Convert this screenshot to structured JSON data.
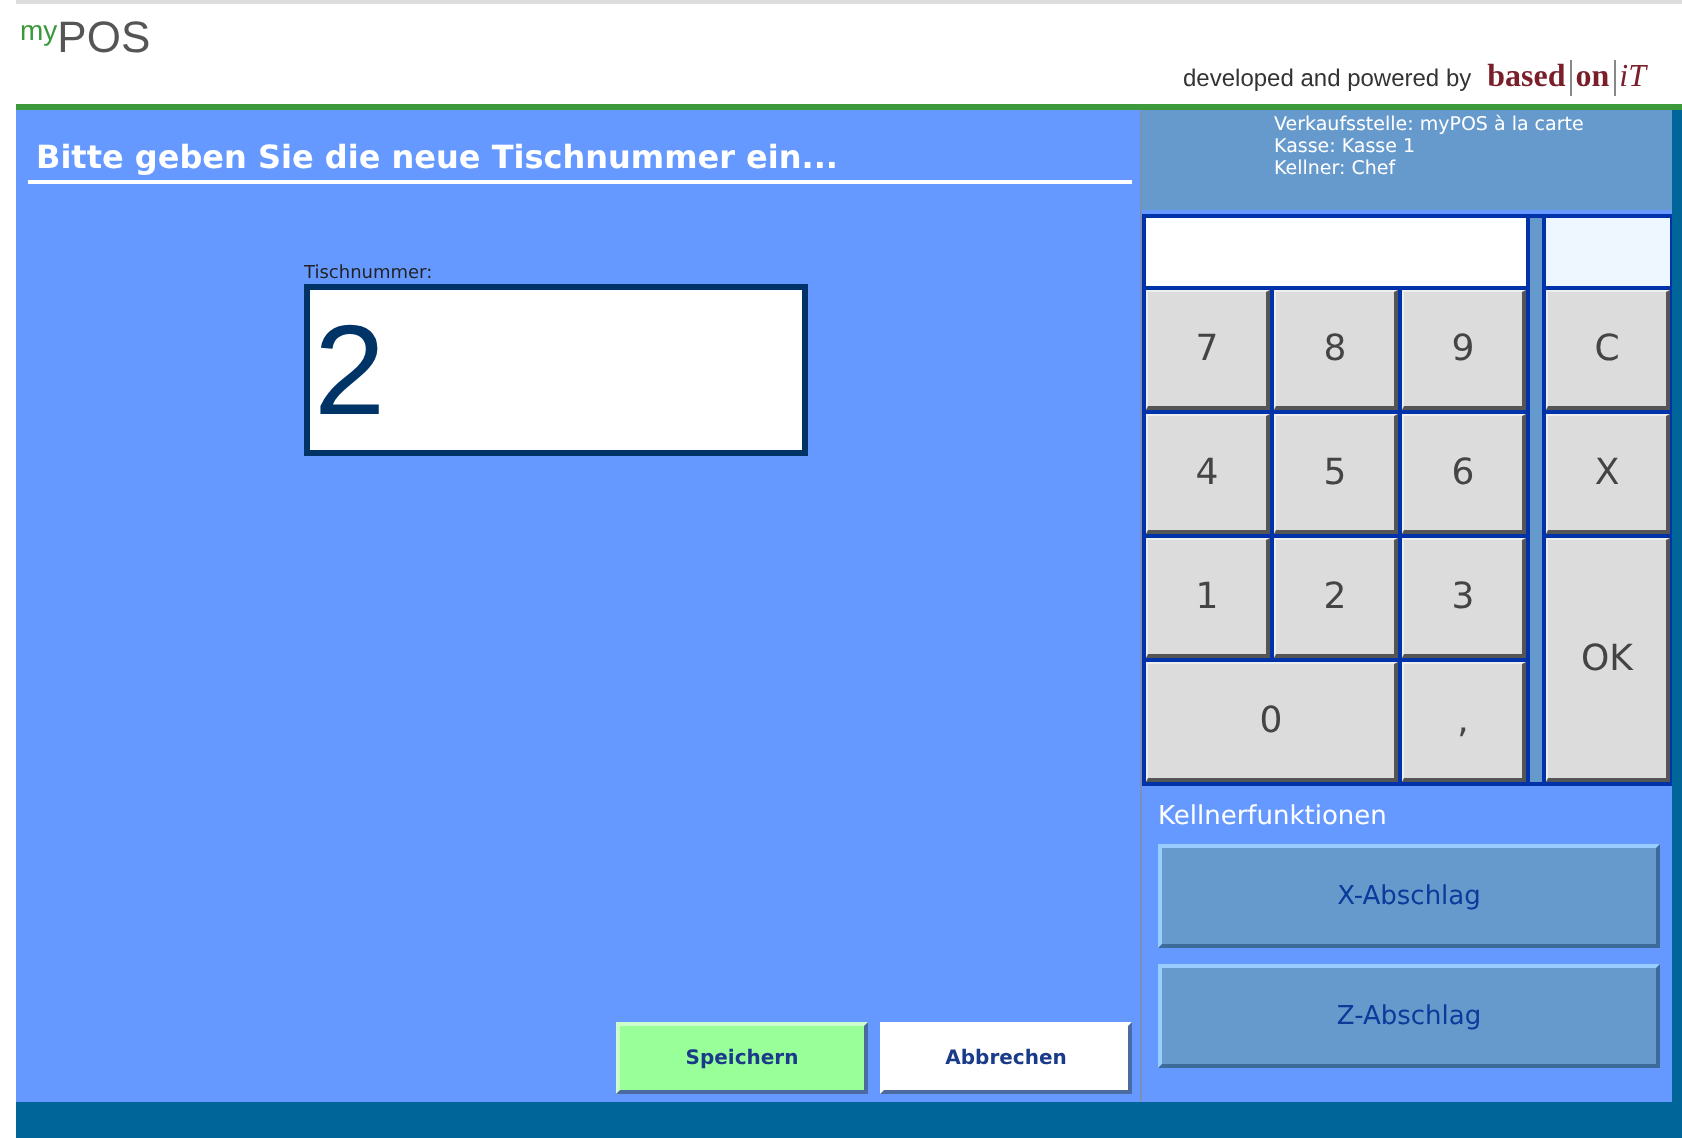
{
  "header": {
    "logo": "$^{my}$POS",
    "credit": "developed and powered by",
    "brand": [
      "based",
      "on",
      "iT"
    ]
  },
  "dialog": {
    "title": "Bitte geben Sie die neue Tischnummer ein...",
    "field": {
      "label": "Tischnummer:",
      "value": "2"
    },
    "buttons": [
      {
        "label": "Speichern",
        "kind": "primary"
      },
      {
        "label": "Abbrechen",
        "kind": "secondary"
      }
    ]
  },
  "info": [
    "Verkaufsstelle: myPOS à la carte",
    "Kasse: Kasse 1",
    "Kellner: Chef"
  ],
  "keypad": {
    "keys": [
      {
        "label": "7",
        "kind": "digit"
      },
      {
        "label": "8",
        "kind": "digit"
      },
      {
        "label": "9",
        "kind": "digit"
      },
      {
        "label": "C",
        "kind": "side"
      },
      {
        "label": "4",
        "kind": "digit"
      },
      {
        "label": "5",
        "kind": "digit"
      },
      {
        "label": "6",
        "kind": "digit"
      },
      {
        "label": "X",
        "kind": "side"
      },
      {
        "label": "1",
        "kind": "digit"
      },
      {
        "label": "2",
        "kind": "digit"
      },
      {
        "label": "3",
        "kind": "digit"
      },
      {
        "label": "OK",
        "kind": "tall"
      },
      {
        "label": "0",
        "kind": "wide"
      },
      {
        "label": ",",
        "kind": "digit"
      }
    ]
  },
  "waiter_functions": {
    "title": "Kellnerfunktionen",
    "buttons": [
      "X-Abschlag",
      "Z-Abschlag"
    ]
  }
}
